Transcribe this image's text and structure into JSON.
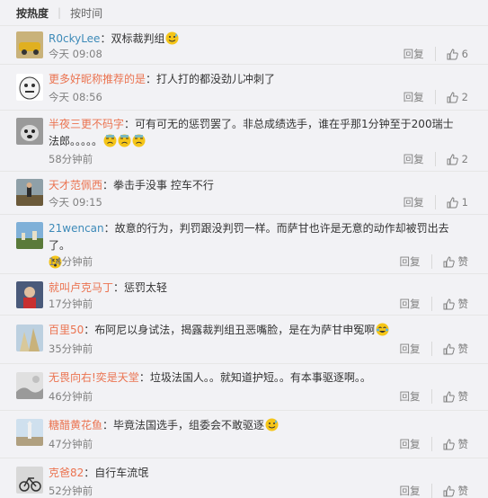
{
  "sort": {
    "hot_label": "按热度",
    "time_label": "按时间"
  },
  "comments": [
    {
      "user": "R0ckyLee",
      "sep": "：",
      "text": "双标裁判组",
      "emoji_count": 1,
      "emoji": "sweat-smile-emoji",
      "time": "今天 09:08",
      "reply": "回复",
      "likes": "6",
      "name_color": "#3d8ab8"
    },
    {
      "user": "更多好昵称推荐的是",
      "sep": "：",
      "text": "打人打的都没劲儿冲刺了",
      "emoji_count": 0,
      "time": "今天 08:56",
      "reply": "回复",
      "likes": "2",
      "name_color": "#eb7350"
    },
    {
      "user": "半夜三更不码字",
      "sep": "：",
      "text": "可有可无的惩罚罢了。非总成绩选手，谁在乎那1分钟至于200瑞士法郎。。。。。",
      "emoji_count": 3,
      "emoji": "sweat-emoji",
      "time": "58分钟前",
      "reply": "回复",
      "likes": "2",
      "name_color": "#eb7350"
    },
    {
      "user": "天才范佩西",
      "sep": "：",
      "text": "拳击手没事 控车不行",
      "emoji_count": 0,
      "time": "今天 09:15",
      "reply": "回复",
      "likes": "1",
      "name_color": "#eb7350"
    },
    {
      "user": "21wencan",
      "sep": "：",
      "text": "故意的行为，判罚跟没判罚一样。而萨甘也许是无意的动作却被罚出去了。",
      "emoji_count": 1,
      "emoji": "dizzy-emoji",
      "time": "14分钟前",
      "reply": "回复",
      "likes": "赞",
      "name_color": "#3d8ab8"
    },
    {
      "user": "就叫卢克马丁",
      "sep": "：",
      "text": "惩罚太轻",
      "emoji_count": 0,
      "time": "17分钟前",
      "reply": "回复",
      "likes": "赞",
      "name_color": "#eb7350"
    },
    {
      "user": "百里50",
      "sep": "：",
      "text": "布阿尼以身试法，揭露裁判组丑恶嘴脸，是在为萨甘申冤啊",
      "emoji_count": 1,
      "emoji": "laugh-cry-emoji",
      "time": "35分钟前",
      "reply": "回复",
      "likes": "赞",
      "name_color": "#eb7350"
    },
    {
      "user": "无畏向右!奕是天堂",
      "sep": "：",
      "text": "垃圾法国人。。就知道护短。。有本事驱逐啊。。",
      "emoji_count": 0,
      "time": "46分钟前",
      "reply": "回复",
      "likes": "赞",
      "name_color": "#eb7350"
    },
    {
      "user": "糖醋黄花鱼",
      "sep": "：",
      "text": "毕竟法国选手，组委会不敢驱逐",
      "emoji_count": 1,
      "emoji": "sweat-smile-emoji",
      "time": "47分钟前",
      "reply": "回复",
      "likes": "赞",
      "name_color": "#eb7350"
    },
    {
      "user": "克爸82",
      "sep": "：",
      "text": "自行车流氓",
      "emoji_count": 0,
      "time": "52分钟前",
      "reply": "回复",
      "likes": "赞",
      "name_color": "#eb7350"
    }
  ]
}
